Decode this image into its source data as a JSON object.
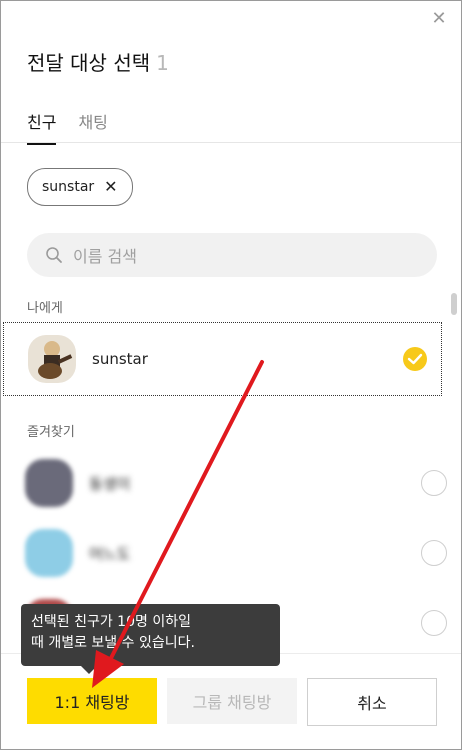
{
  "header": {
    "title": "전달 대상 선택",
    "count": "1",
    "close_icon": "close-icon"
  },
  "tabs": [
    {
      "label": "친구"
    },
    {
      "label": "채팅"
    }
  ],
  "chips": [
    {
      "label": "sunstar"
    }
  ],
  "search": {
    "placeholder": "이름 검색"
  },
  "sections": {
    "me": "나에게",
    "favorites": "즐겨찾기"
  },
  "me_row": {
    "name": "sunstar",
    "selected": true
  },
  "favorites": [
    {
      "name": "동생이",
      "selected": false
    },
    {
      "name": "어느도",
      "selected": false
    },
    {
      "name": "다도",
      "selected": false
    }
  ],
  "tooltip": {
    "line1": "선택된 친구가 10명 이하일",
    "line2": "때 개별로 보낼 수 있습니다."
  },
  "buttons": {
    "one_to_one": "1:1 채팅방",
    "group": "그룹 채팅방",
    "cancel": "취소"
  },
  "colors": {
    "accent": "#fedc00",
    "check": "#f7c91a",
    "tooltip_bg": "#3c3c3c",
    "annotation_arrow": "#e0191e"
  }
}
